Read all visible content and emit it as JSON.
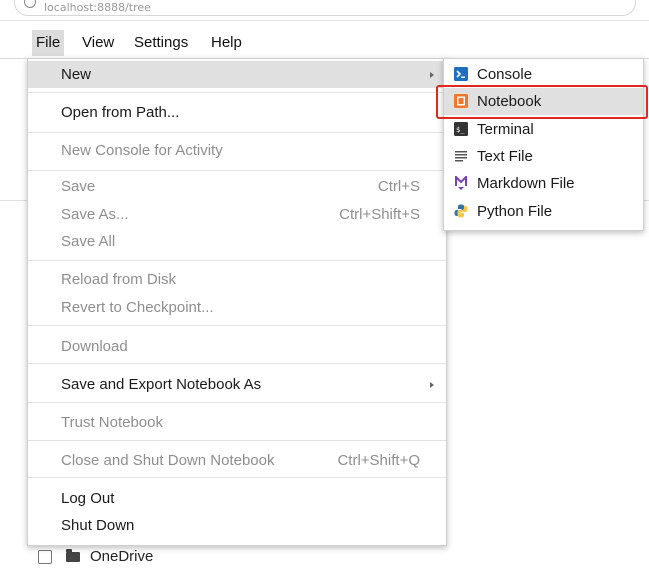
{
  "browser": {
    "url": "localhost:8888/tree"
  },
  "menubar": {
    "items": [
      {
        "label": "File"
      },
      {
        "label": "View"
      },
      {
        "label": "Settings"
      },
      {
        "label": "Help"
      }
    ]
  },
  "file_menu": {
    "new": {
      "label": "New"
    },
    "open_from_path": {
      "label": "Open from Path..."
    },
    "new_console": {
      "label": "New Console for Activity"
    },
    "save": {
      "label": "Save",
      "shortcut": "Ctrl+S"
    },
    "save_as": {
      "label": "Save As...",
      "shortcut": "Ctrl+Shift+S"
    },
    "save_all": {
      "label": "Save All"
    },
    "reload": {
      "label": "Reload from Disk"
    },
    "revert": {
      "label": "Revert to Checkpoint..."
    },
    "download": {
      "label": "Download"
    },
    "save_export": {
      "label": "Save and Export Notebook As"
    },
    "trust": {
      "label": "Trust Notebook"
    },
    "close_shutdown": {
      "label": "Close and Shut Down Notebook",
      "shortcut": "Ctrl+Shift+Q"
    },
    "log_out": {
      "label": "Log Out"
    },
    "shut_down": {
      "label": "Shut Down"
    }
  },
  "new_submenu": {
    "items": [
      {
        "label": "Console",
        "icon": "console-icon"
      },
      {
        "label": "Notebook",
        "icon": "notebook-icon"
      },
      {
        "label": "Terminal",
        "icon": "terminal-icon"
      },
      {
        "label": "Text File",
        "icon": "text-file-icon"
      },
      {
        "label": "Markdown File",
        "icon": "markdown-icon"
      },
      {
        "label": "Python File",
        "icon": "python-icon"
      }
    ]
  },
  "file_browser": {
    "row_name": "OneDrive"
  },
  "colors": {
    "highlight_border": "#e0281f",
    "active_row": "#e0e0e0",
    "disabled_text": "#8e8e8e",
    "console_icon": "#1f6fc1",
    "notebook_icon": "#f37726",
    "markdown_icon": "#7b3fb5",
    "python_blue": "#3572a5",
    "python_yellow": "#f7c948"
  }
}
